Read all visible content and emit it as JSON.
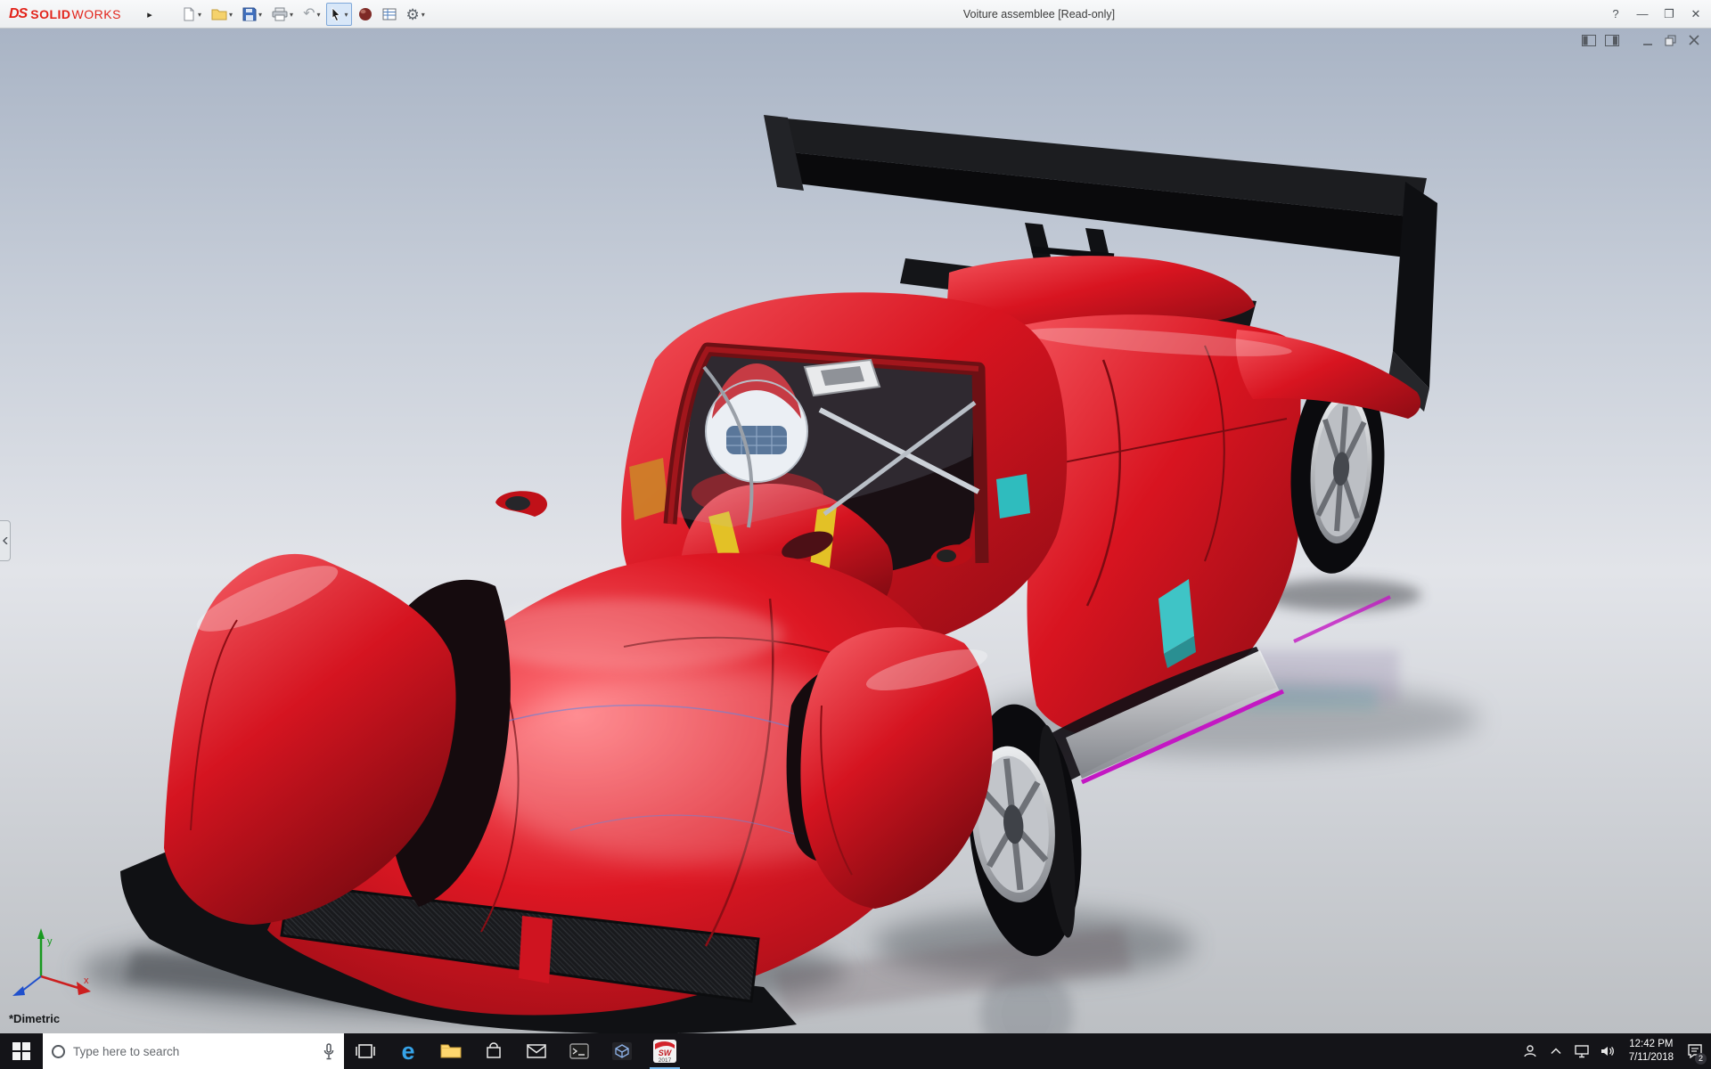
{
  "titlebar": {
    "brand": {
      "prefix": "DS",
      "solid": "SOLID",
      "works": "WORKS"
    },
    "title": "Voiture assemblee [Read-only]",
    "controls": {
      "help": "?",
      "minimize": "—",
      "restore": "❐",
      "close": "✕"
    }
  },
  "icons": {
    "flyout_arrow": "▸",
    "caret": "▾",
    "undo_arrow": "↶",
    "gear": "⚙",
    "edge_e": "e"
  },
  "toolbar": {
    "items": [
      "new-document",
      "open",
      "save",
      "print",
      "undo",
      "select-cursor",
      "appearance-sphere",
      "design-table",
      "options-gear"
    ]
  },
  "viewport": {
    "orientation_label": "*Dimetric",
    "triad_labels": {
      "x": "x",
      "y": "y"
    },
    "doc_controls": [
      "pane-left",
      "pane-right",
      "minimize",
      "restore",
      "close"
    ]
  },
  "scene": {
    "model": "red open-cockpit race car with driver",
    "body_color": "#d81420",
    "wing_color": "#0d0d10",
    "magenta_trim": "#c318c3",
    "cyan_glass": "#3fc4c6",
    "helmet_color": "#f4f5f7"
  },
  "taskbar": {
    "search_placeholder": "Type here to search",
    "apps": [
      "start",
      "search",
      "task-view",
      "edge",
      "file-explorer",
      "store",
      "mail",
      "terminal",
      "cube-app",
      "solidworks"
    ],
    "solidworks_icon": {
      "letters": "SW",
      "year": "2017"
    },
    "tray": {
      "icons": [
        "people",
        "hidden-icons-chevron",
        "network",
        "volume",
        "action-center"
      ],
      "time": "12:42 PM",
      "date": "7/11/2018",
      "notification_count": "2"
    }
  }
}
